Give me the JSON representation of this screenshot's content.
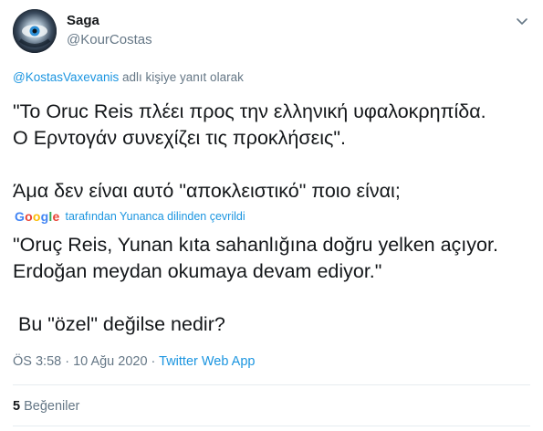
{
  "tweet": {
    "author_name": "Saga",
    "author_handle": "@KourCostas",
    "reply_mention": "@KostasVaxevanis",
    "reply_suffix": " adlı kişiye yanıt olarak",
    "text_lines": [
      "\"Το Oruc Reis πλέει προς την ελληνική υφαλοκρηπίδα.",
      "Ο Ερντογάν συνεχίζει τις προκλήσεις\".",
      "",
      "Άμα δεν είναι αυτό \"αποκλειστικό\" ποιο είναι;"
    ],
    "translation": {
      "provider": "Google",
      "label": "tarafından Yunanca dilinden çevrildi",
      "lines": [
        "\"Oruç Reis, Yunan kıta sahanlığına doğru yelken açıyor.",
        "Erdoğan meydan okumaya devam ediyor.\"",
        "",
        " Bu \"özel\" değilse nedir?"
      ]
    },
    "timestamp": "ÖS 3:58 · 10 Ağu 2020",
    "separator": " · ",
    "source": "Twitter Web App",
    "likes_count": "5",
    "likes_label": " Beğeniler"
  },
  "icons": {
    "caret": "chevron-down-icon",
    "avatar": "avatar"
  },
  "colors": {
    "text": "#14171a",
    "muted": "#657786",
    "link": "#1b95e0",
    "divider": "#e6ecf0",
    "google": [
      "#4285F4",
      "#EA4335",
      "#FBBC05",
      "#4285F4",
      "#34A853",
      "#EA4335"
    ]
  }
}
